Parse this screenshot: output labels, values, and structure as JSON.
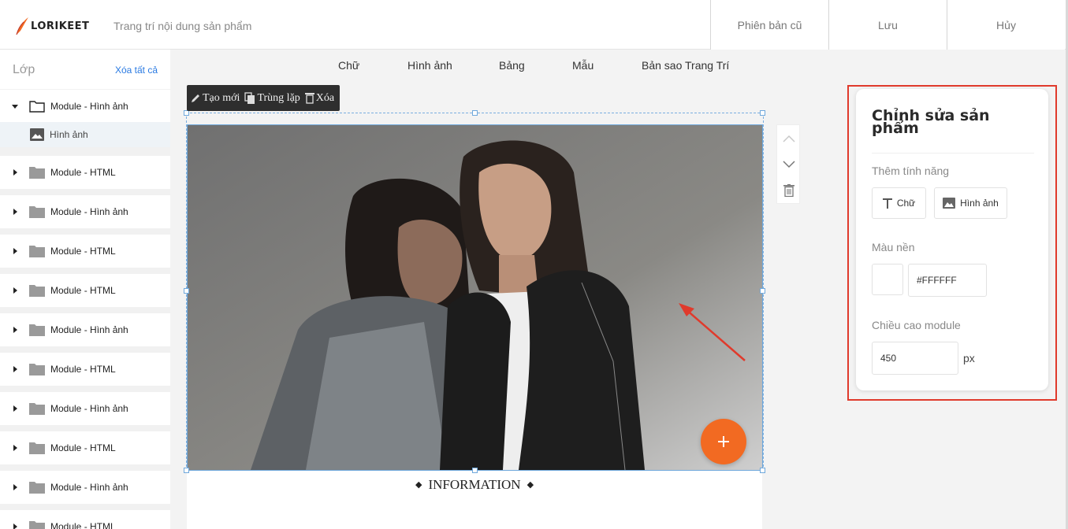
{
  "header": {
    "logo_text": "LORIKEET",
    "subtitle": "Trang trí nội dung sản phẩm",
    "buttons": {
      "old_version": "Phiên bản cũ",
      "save": "Lưu",
      "cancel": "Hủy"
    }
  },
  "layers": {
    "title": "Lớp",
    "clear_all": "Xóa tất cả",
    "items": [
      {
        "label": "Module - Hình ảnh",
        "expanded": true
      },
      {
        "label": "Module - HTML"
      },
      {
        "label": "Module - Hình ảnh"
      },
      {
        "label": "Module - HTML"
      },
      {
        "label": "Module - HTML"
      },
      {
        "label": "Module - Hình ảnh"
      },
      {
        "label": "Module - HTML"
      },
      {
        "label": "Module - Hình ảnh"
      },
      {
        "label": "Module - HTML"
      },
      {
        "label": "Module - Hình ảnh"
      },
      {
        "label": "Module - HTML"
      }
    ],
    "child": {
      "label": "Hình ảnh"
    }
  },
  "tool_menu": [
    "Chữ",
    "Hình ảnh",
    "Bảng",
    "Mẫu",
    "Bản sao Trang Trí"
  ],
  "action_bar": {
    "create": "Tạo mới",
    "duplicate": "Trùng lặp",
    "delete": "Xóa"
  },
  "canvas": {
    "info_title": "INFORMATION"
  },
  "properties": {
    "title": "Chỉnh sửa sản phẩm",
    "add_feature_label": "Thêm tính năng",
    "features": {
      "text": "Chữ",
      "image": "Hình ảnh"
    },
    "bg_color_label": "Màu nền",
    "bg_color_value": "#FFFFFF",
    "height_label": "Chiều cao module",
    "height_value": "450",
    "height_unit": "px"
  },
  "colors": {
    "accent": "#f26a22",
    "highlight": "#e03a2c",
    "link": "#2a7ae2"
  },
  "icons": [
    "feather-logo",
    "caret-icon",
    "folder-icon",
    "image-icon",
    "pencil-icon",
    "copy-icon",
    "trash-icon",
    "chevron-up-icon",
    "chevron-down-icon",
    "plus-icon",
    "text-icon"
  ]
}
